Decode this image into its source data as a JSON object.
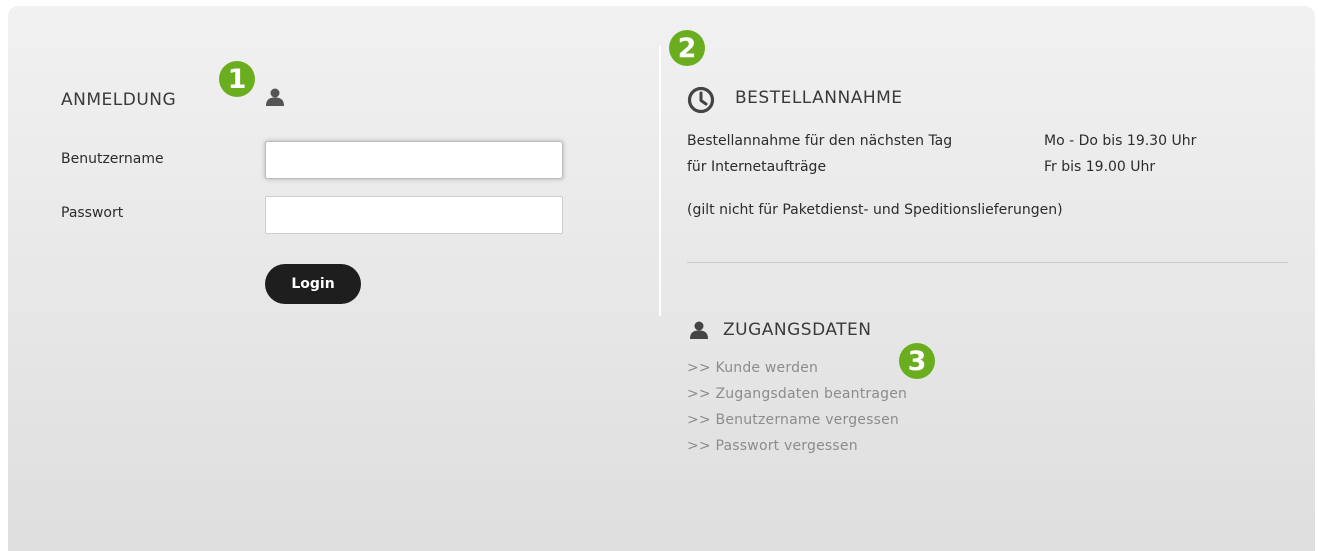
{
  "login": {
    "title": "ANMELDUNG",
    "marker": "1",
    "username_label": "Benutzername",
    "username_value": "",
    "password_label": "Passwort",
    "password_value": "",
    "login_button": "Login"
  },
  "order": {
    "marker": "2",
    "title": "BESTELLANNAHME",
    "line1_left": "Bestellannahme für den nächsten Tag",
    "line2_left": "für Internetaufträge",
    "line1_right": "Mo - Do bis 19.30 Uhr",
    "line2_right": "Fr bis 19.00 Uhr",
    "note": "(gilt nicht für Paketdienst- und Speditionslieferungen)"
  },
  "access": {
    "marker": "3",
    "title": "ZUGANGSDATEN",
    "links": [
      ">> Kunde werden",
      ">> Zugangsdaten beantragen",
      ">> Benutzername vergessen",
      ">> Passwort vergessen"
    ]
  },
  "icons": {
    "user": "user-icon",
    "clock": "clock-icon"
  },
  "colors": {
    "marker_green": "#6aae1f",
    "button_dark": "#1e1e1e",
    "link_gray": "#8c8c8c",
    "panel_bg": "#e8e8e8"
  }
}
